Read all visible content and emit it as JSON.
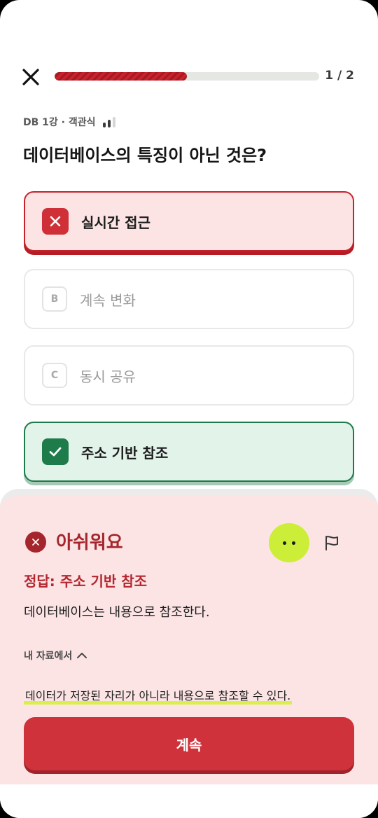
{
  "header": {
    "progress_text": "1 / 2",
    "progress_fraction": 0.5,
    "progress_color": "#c8232d"
  },
  "meta": {
    "text": "DB 1강 · 객관식",
    "difficulty_icon": "signal-bars-icon"
  },
  "question": "데이터베이스의 특징이 아닌 것은?",
  "options": [
    {
      "letter": "",
      "label": "실시간 접근",
      "state": "selected-wrong",
      "icon": "x-icon",
      "color": "#c4232c"
    },
    {
      "letter": "B",
      "label": "계속 변화",
      "state": "neutral"
    },
    {
      "letter": "C",
      "label": "동시 공유",
      "state": "neutral"
    },
    {
      "letter": "",
      "label": "주소 기반 참조",
      "state": "correct",
      "icon": "check-icon",
      "color": "#1d7a4a"
    }
  ],
  "feedback": {
    "title": "아쉬워요",
    "answer": "정답: 주소 기반 참조",
    "explanation": "데이터베이스는 내용으로 참조한다.",
    "source_label": "내 자료에서",
    "source_quote": "데이터가 저장된 자리가 아니라 내용으로 참조할 수 있다.",
    "continue_label": "계속",
    "accent": "#a5252c",
    "highlight": "#d9f04a"
  }
}
